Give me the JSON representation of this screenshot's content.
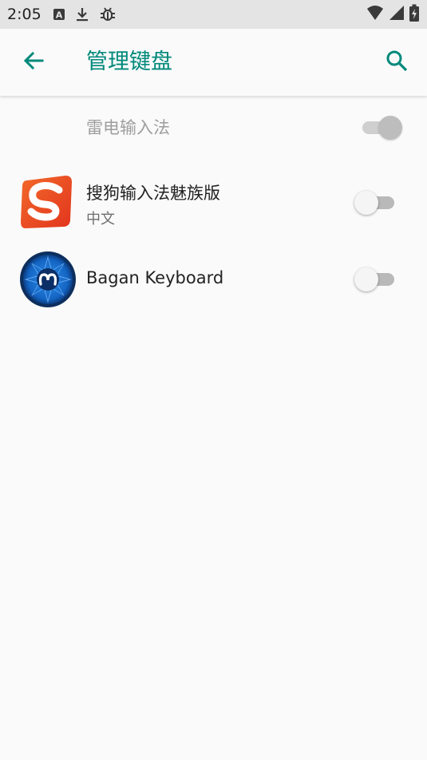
{
  "status_bar": {
    "time": "2:05",
    "icons": [
      "a-box-icon",
      "download-icon",
      "bug-icon"
    ],
    "right_icons": [
      "wifi-icon",
      "signal-icon",
      "battery-charging-icon"
    ]
  },
  "app_bar": {
    "title": "管理键盘",
    "back_icon": "arrow-back-icon",
    "search_icon": "search-icon",
    "accent_color": "#00897b"
  },
  "keyboards": [
    {
      "name": "雷电输入法",
      "subtitle": "",
      "enabled": true,
      "disabled_state": true
    },
    {
      "name": "搜狗输入法魅族版",
      "subtitle": "中文",
      "enabled": false,
      "icon": "sogou-logo-icon"
    },
    {
      "name": "Bagan Keyboard",
      "subtitle": "",
      "enabled": false,
      "icon": "bagan-logo-icon"
    }
  ]
}
